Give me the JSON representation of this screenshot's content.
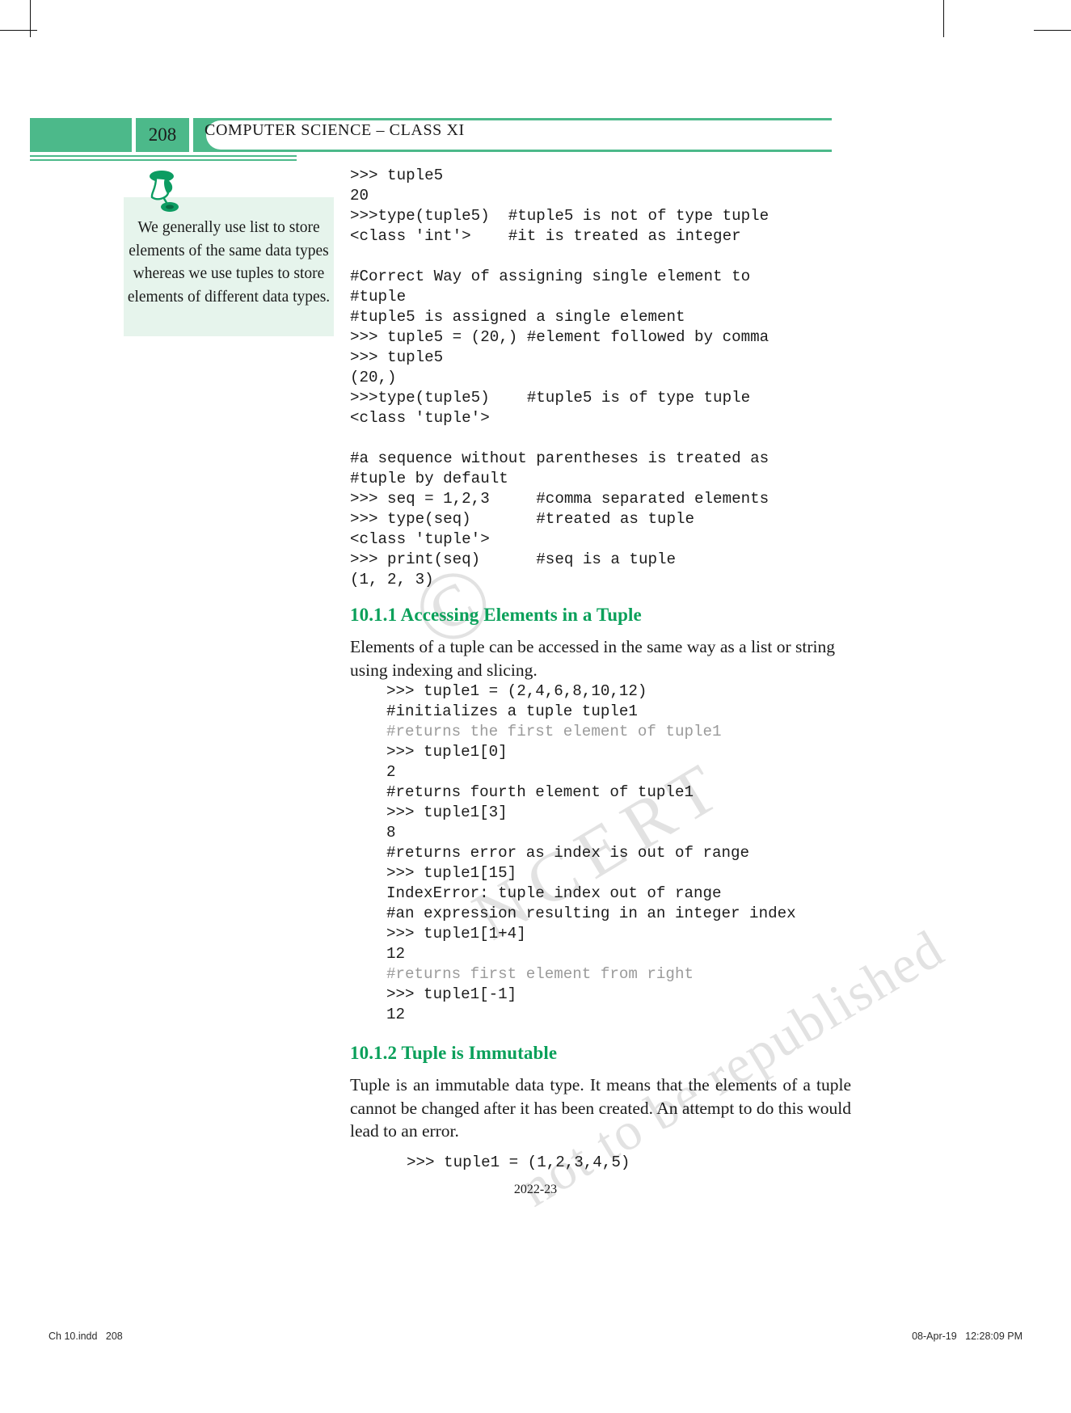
{
  "header": {
    "page_number": "208",
    "title_small_caps": "COMPUTER SCIENCE – CLASS XI",
    "title_parts": {
      "c1": "C",
      "w1": "OMPUTER",
      "c2": " S",
      "w2": "CIENCE",
      "dash": " – ",
      "c3": "C",
      "w3": "LASS",
      "c4": " XI"
    },
    "accent_color": "#4cb98a"
  },
  "note": {
    "icon": "pushpin-icon",
    "text": "We generally use list to store elements of the same data types whereas we use tuples to store elements of different data types.",
    "background_color": "#e6f4ec"
  },
  "watermark": {
    "line1": "©",
    "line2": "NCERT",
    "line3": "not to be republished"
  },
  "code_block_1": [
    ">>> tuple5",
    "20",
    ">>>type(tuple5)  #tuple5 is not of type tuple",
    "<class 'int'>    #it is treated as integer",
    "",
    "#Correct Way of assigning single element to",
    "#tuple",
    "#tuple5 is assigned a single element",
    ">>> tuple5 = (20,) #element followed by comma",
    ">>> tuple5",
    "(20,)",
    ">>>type(tuple5)    #tuple5 is of type tuple",
    "<class 'tuple'>",
    "",
    "#a sequence without parentheses is treated as",
    "#tuple by default",
    ">>> seq = 1,2,3     #comma separated elements",
    ">>> type(seq)       #treated as tuple",
    "<class 'tuple'>",
    ">>> print(seq)      #seq is a tuple",
    "(1, 2, 3)"
  ],
  "section_1": {
    "heading": "10.1.1 Accessing Elements in a Tuple",
    "paragraph": "Elements of a tuple can be accessed in the same way as a list or string using indexing and slicing."
  },
  "code_block_2": [
    {
      "text": ">>> tuple1 = (2,4,6,8,10,12)",
      "dim": false
    },
    {
      "text": "#initializes a tuple tuple1",
      "dim": false
    },
    {
      "text": "#returns the first element of tuple1",
      "dim": true
    },
    {
      "text": ">>> tuple1[0]",
      "dim": false
    },
    {
      "text": "2",
      "dim": false
    },
    {
      "text": "#returns fourth element of tuple1",
      "dim": false
    },
    {
      "text": ">>> tuple1[3]",
      "dim": false
    },
    {
      "text": "8",
      "dim": false
    },
    {
      "text": "#returns error as index is out of range",
      "dim": false
    },
    {
      "text": ">>> tuple1[15]",
      "dim": false
    },
    {
      "text": "IndexError: tuple index out of range",
      "dim": false
    },
    {
      "text": "#an expression resulting in an integer index",
      "dim": false
    },
    {
      "text": ">>> tuple1[1+4]",
      "dim": false
    },
    {
      "text": "12",
      "dim": false
    },
    {
      "text": "#returns first element from right",
      "dim": true
    },
    {
      "text": ">>> tuple1[-1]",
      "dim": false
    },
    {
      "text": "12",
      "dim": false
    }
  ],
  "section_2": {
    "heading": "10.1.2 Tuple is Immutable",
    "paragraph": "Tuple is an immutable data type. It means that the elements of a tuple cannot be changed after it has been created. An attempt to do this would lead to an error."
  },
  "code_block_3": [
    ">>> tuple1 = (1,2,3,4,5)"
  ],
  "footer": {
    "center": "2022-23",
    "left": "Ch 10.indd   208",
    "right": "08-Apr-19   12:28:09 PM"
  }
}
